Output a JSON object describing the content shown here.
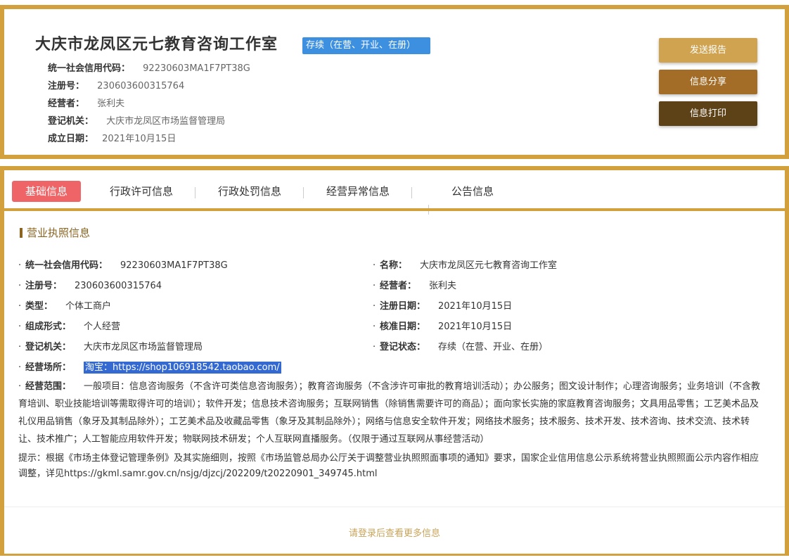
{
  "header": {
    "company_name": "大庆市龙凤区元七教育咨询工作室",
    "status_badge": "存续（在营、开业、在册）",
    "fields": [
      {
        "label": "统一社会信用代码：",
        "value": "92230603MA1F7PT38G"
      },
      {
        "label": "注册号：",
        "value": "230603600315764"
      },
      {
        "label": "经营者：",
        "value": "张利夫"
      },
      {
        "label": "登记机关：",
        "value": "大庆市龙凤区市场监督管理局"
      },
      {
        "label": "成立日期：",
        "value": "2021年10月15日"
      }
    ],
    "buttons": {
      "report": "发送报告",
      "share": "信息分享",
      "print": "信息打印"
    }
  },
  "tabs": [
    {
      "label": "基础信息",
      "active": true
    },
    {
      "label": "行政许可信息"
    },
    {
      "label": "行政处罚信息"
    },
    {
      "label": "经营异常信息"
    },
    {
      "label": "公告信息"
    }
  ],
  "section_title": "营业执照信息",
  "left_fields": [
    {
      "label": "统一社会信用代码：",
      "value": "92230603MA1F7PT38G"
    },
    {
      "label": "注册号：",
      "value": "230603600315764"
    },
    {
      "label": "类型：",
      "value": "个体工商户"
    },
    {
      "label": "组成形式：",
      "value": "个人经营"
    },
    {
      "label": "登记机关：",
      "value": "大庆市龙凤区市场监督管理局"
    },
    {
      "label": "经营场所：",
      "value": "淘宝：https://shop106918542.taobao.com/"
    }
  ],
  "right_fields": [
    {
      "label": "名称：",
      "value": "大庆市龙凤区元七教育咨询工作室"
    },
    {
      "label": "经营者：",
      "value": "张利夫"
    },
    {
      "label": "注册日期：",
      "value": "2021年10月15日"
    },
    {
      "label": "核准日期：",
      "value": "2021年10月15日"
    },
    {
      "label": "登记状态：",
      "value": "存续（在营、开业、在册）"
    }
  ],
  "scope": {
    "label": "经营范围：",
    "value": "一般项目：信息咨询服务（不含许可类信息咨询服务）；教育咨询服务（不含涉许可审批的教育培训活动）；办公服务；图文设计制作；心理咨询服务；业务培训（不含教育培训、职业技能培训等需取得许可的培训）；软件开发；信息技术咨询服务；互联网销售（除销售需要许可的商品）；面向家长实施的家庭教育咨询服务；文具用品零售；工艺美术品及礼仪用品销售（象牙及其制品除外）；工艺美术品及收藏品零售（象牙及其制品除外）；网络与信息安全软件开发；网络技术服务；技术服务、技术开发、技术咨询、技术交流、技术转让、技术推广；人工智能应用软件开发；物联网技术研发；个人互联网直播服务。（仅限于通过互联网从事经营活动）"
  },
  "hint": "提示：根据《市场主体登记管理条例》及其实施细则，按照《市场监管总局办公厅关于调整营业执照照面事项的通知》要求，国家企业信用信息公示系统将营业执照照面公示内容作相应调整，详见https://gkml.samr.gov.cn/nsjg/djzcj/202209/t20220901_349745.html",
  "login_hint": "请登录后查看更多信息",
  "colors": {
    "frame": "#d2a03c",
    "badge": "#3d8fe0",
    "active_tab": "#ef6466",
    "btn_report": "#cfa350",
    "btn_share": "#a36d28",
    "btn_print": "#5e4217"
  }
}
